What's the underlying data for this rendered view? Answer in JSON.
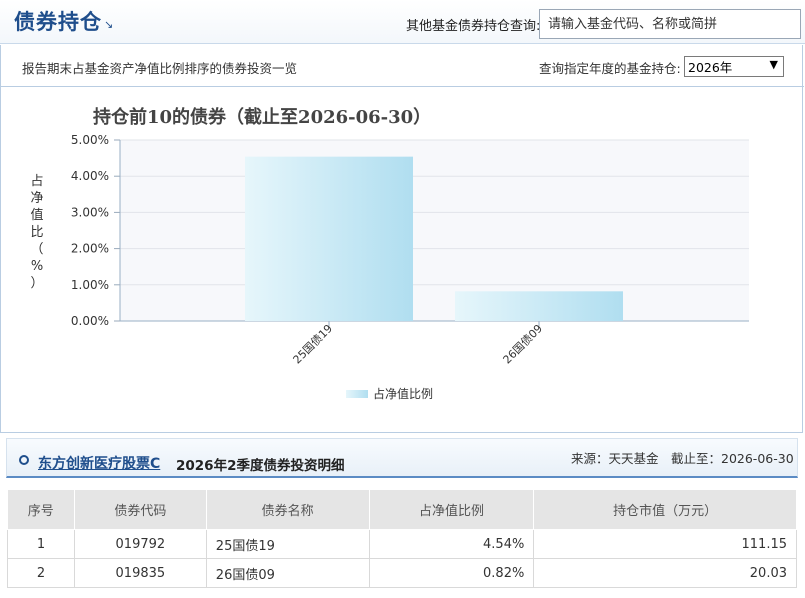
{
  "header": {
    "title": "债券持仓",
    "title_arrow": "↘",
    "query_label": "其他基金债券持仓查询:",
    "search_placeholder": "请输入基金代码、名称或简拼"
  },
  "filter_bar": {
    "description": "报告期末占基金资产净值比例排序的债券投资一览",
    "year_label": "查询指定年度的基金持仓:",
    "year_selected": "2026年"
  },
  "chart_data": {
    "type": "bar",
    "title": "持仓前10的债券（截止至2026-06-30）",
    "ylabel": "占净值比（%）",
    "categories": [
      "25国债19",
      "26国债09"
    ],
    "values": [
      4.54,
      0.82
    ],
    "ylim": [
      0,
      5
    ],
    "yticks": [
      "0.00%",
      "1.00%",
      "2.00%",
      "3.00%",
      "4.00%",
      "5.00%"
    ],
    "ytick_values": [
      0,
      1,
      2,
      3,
      4,
      5
    ],
    "legend": "占净值比例",
    "legend_position": "bottom",
    "grid": true,
    "bar_color_start": "#e6f6fb",
    "bar_color_end": "#b0def0"
  },
  "detail": {
    "fund_name": "东方创新医疗股票C",
    "section_title": "2026年2季度债券投资明细",
    "source": "来源：天天基金",
    "as_of": "截止至：2026-06-30"
  },
  "table": {
    "headers": [
      "序号",
      "债券代码",
      "债券名称",
      "占净值比例",
      "持仓市值（万元）"
    ],
    "rows": [
      [
        "1",
        "019792",
        "25国债19",
        "4.54%",
        "111.15"
      ],
      [
        "2",
        "019835",
        "26国债09",
        "0.82%",
        "20.03"
      ]
    ]
  },
  "colors": {
    "brand": "#1f4e8c",
    "border": "#b9cde2"
  }
}
